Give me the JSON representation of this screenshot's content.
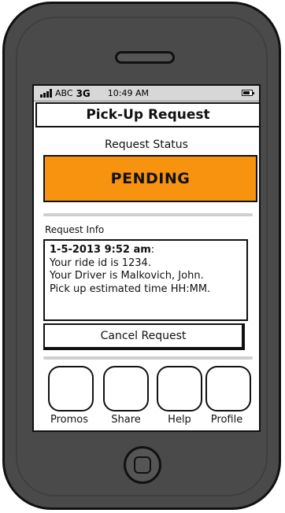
{
  "status_bar": {
    "carrier": "ABC",
    "network": "3G",
    "time": "10:49 AM",
    "icons": [
      "signal-bars-icon",
      "battery-icon"
    ]
  },
  "header": {
    "title": "Pick-Up Request"
  },
  "request_status": {
    "label": "Request Status",
    "value": "PENDING",
    "color": "#f7930f"
  },
  "request_info": {
    "label": "Request Info",
    "date_time": "1-5-2013 9:52 am",
    "date_time_suffix": ":",
    "lines": [
      "Your ride id is 1234.",
      "Your Driver is Malkovich, John.",
      "Pick up estimated time HH:MM."
    ]
  },
  "cancel_button": {
    "label": "Cancel Request"
  },
  "tabs": [
    {
      "label": "Promos"
    },
    {
      "label": "Share"
    },
    {
      "label": "Help"
    },
    {
      "label": "Profile"
    }
  ]
}
